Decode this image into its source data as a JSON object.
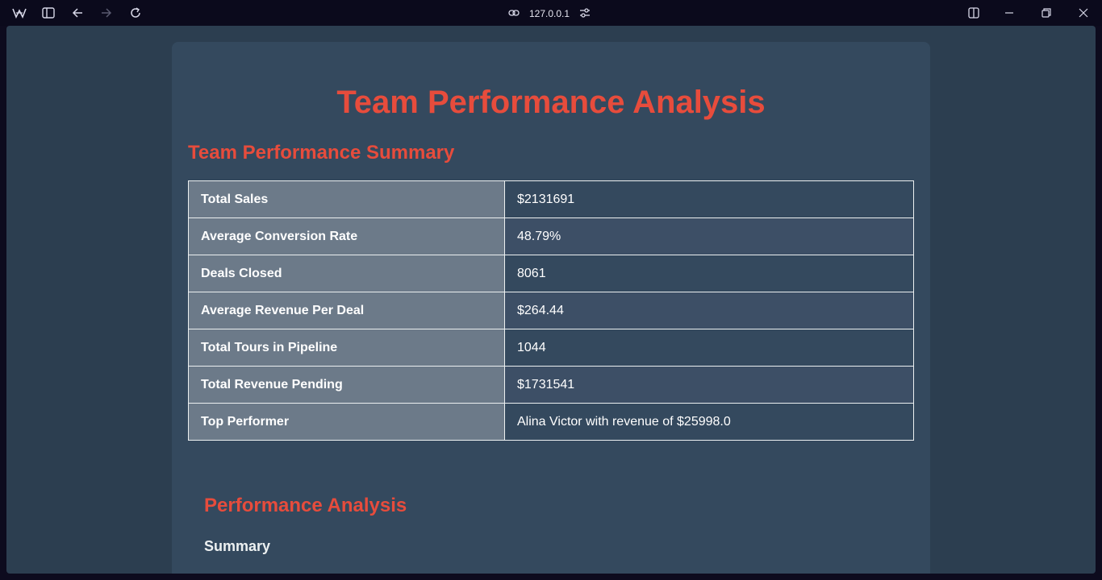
{
  "browser": {
    "url": "127.0.0.1",
    "icons": {
      "logo": "browser-logo-icon",
      "sidebar": "sidebar-toggle-icon",
      "back": "back-arrow-icon",
      "forward": "forward-arrow-icon",
      "reload": "reload-icon",
      "link": "link-icon",
      "settings": "site-settings-icon",
      "split": "split-view-icon",
      "minimize": "minimize-icon",
      "restore": "restore-icon",
      "close": "close-icon"
    }
  },
  "page": {
    "title": "Team Performance Analysis",
    "summary_title": "Team Performance Summary",
    "rows": [
      {
        "label": "Total Sales",
        "value": "$2131691"
      },
      {
        "label": "Average Conversion Rate",
        "value": "48.79%"
      },
      {
        "label": "Deals Closed",
        "value": "8061"
      },
      {
        "label": "Average Revenue Per Deal",
        "value": "$264.44"
      },
      {
        "label": "Total Tours in Pipeline",
        "value": "1044"
      },
      {
        "label": "Total Revenue Pending",
        "value": "$1731541"
      },
      {
        "label": "Top Performer",
        "value": "Alina Victor with revenue of $25998.0"
      }
    ],
    "analysis_title": "Performance Analysis",
    "analysis_summary_label": "Summary"
  },
  "colors": {
    "accent": "#e74c3c",
    "background": "#2c3e50",
    "card": "#34495e",
    "label_cell": "#6c7a89"
  }
}
